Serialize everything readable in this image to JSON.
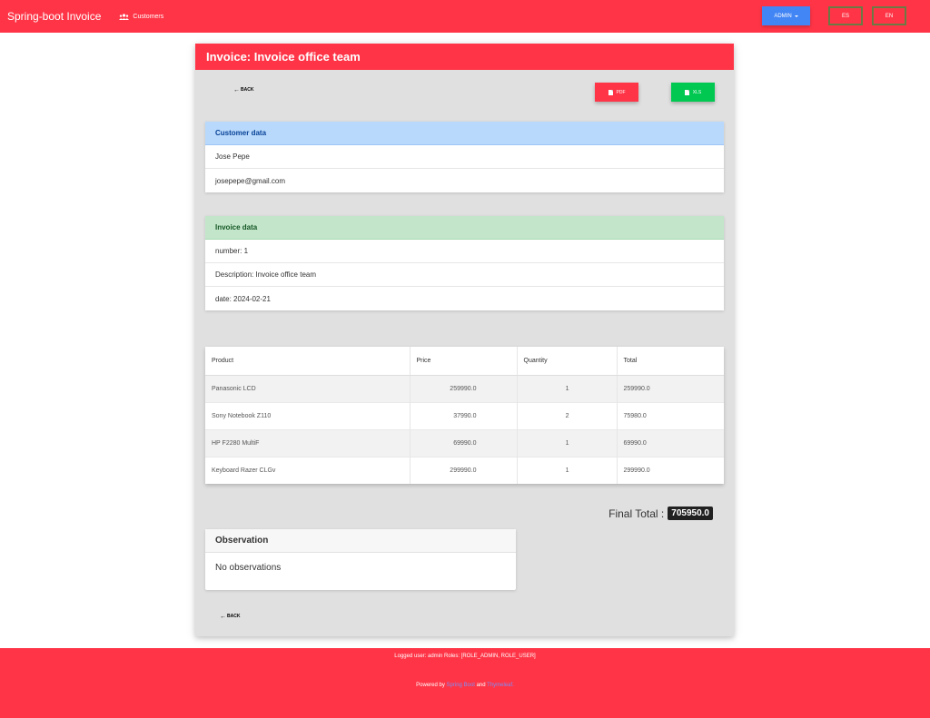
{
  "navbar": {
    "brand": "Spring-boot Invoice",
    "customers_link": "Customers",
    "admin_label": "ADMIN",
    "lang_es": "ES",
    "lang_en": "EN"
  },
  "invoice": {
    "header_title": "Invoice: Invoice office team",
    "back_label": "BACK",
    "pdf_label": "PDF",
    "xls_label": "XLS"
  },
  "customer": {
    "heading": "Customer data",
    "name": "Jose Pepe",
    "email": "josepepe@gmail.com"
  },
  "invoice_data": {
    "heading": "Invoice data",
    "number": "number: 1",
    "description": "Description: Invoice office team",
    "date": "date: 2024-02-21"
  },
  "table": {
    "headers": [
      "Product",
      "Price",
      "Quantity",
      "Total"
    ],
    "rows": [
      {
        "product": "Panasonic LCD",
        "price": "259990.0",
        "quantity": "1",
        "total": "259990.0"
      },
      {
        "product": "Sony Notebook Z110",
        "price": "37990.0",
        "quantity": "2",
        "total": "75980.0"
      },
      {
        "product": "HP F2280 MultiF",
        "price": "69990.0",
        "quantity": "1",
        "total": "69990.0"
      },
      {
        "product": "Keyboard Razer CLGv",
        "price": "299990.0",
        "quantity": "1",
        "total": "299990.0"
      }
    ]
  },
  "final_total": {
    "label": "Final Total :",
    "value": "705950.0"
  },
  "observation": {
    "heading": "Observation",
    "text": "No observations"
  },
  "footer": {
    "logged_user": "Logged user: admin Roles: [ROLE_ADMIN, ROLE_USER]",
    "powered_prefix": "Powered by",
    "link1": "Spring Boot",
    "and": "and",
    "link2": "Thymeleaf."
  },
  "colors": {
    "primary": "#ff3547",
    "admin_blue": "#4285f4",
    "xls_green": "#00c851"
  }
}
